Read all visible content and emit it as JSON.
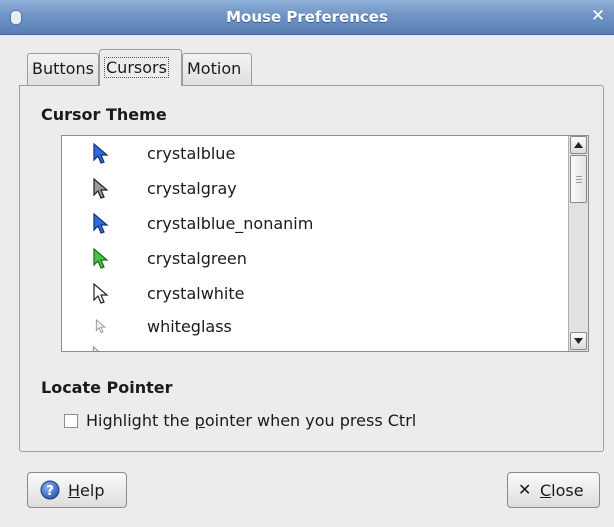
{
  "window": {
    "title": "Mouse Preferences",
    "icon": "mouse-icon",
    "close_icon": "close-icon"
  },
  "tabs": [
    {
      "label": "Buttons",
      "active": false
    },
    {
      "label": "Cursors",
      "active": true
    },
    {
      "label": "Motion",
      "active": false
    }
  ],
  "cursor_theme": {
    "heading": "Cursor Theme",
    "themes": [
      {
        "name": "crystalblue",
        "color": "#2f6be0"
      },
      {
        "name": "crystalgray",
        "color": "#8a8a8a"
      },
      {
        "name": "crystalblue_nonanim",
        "color": "#2f6be0"
      },
      {
        "name": "crystalgreen",
        "color": "#3fbf3f"
      },
      {
        "name": "crystalwhite",
        "color": "#ffffff"
      },
      {
        "name": "whiteglass",
        "color": "#f0f0f0"
      }
    ]
  },
  "locate_pointer": {
    "heading": "Locate Pointer",
    "checkbox_label_pre": "Highlight the ",
    "checkbox_label_mnemonic": "p",
    "checkbox_label_post": "ointer when you press Ctrl",
    "checked": false
  },
  "buttons": {
    "help_mnemonic": "H",
    "help_rest": "elp",
    "help_icon": "help-icon",
    "close_mnemonic": "C",
    "close_rest": "lose",
    "close_icon": "close-icon"
  }
}
